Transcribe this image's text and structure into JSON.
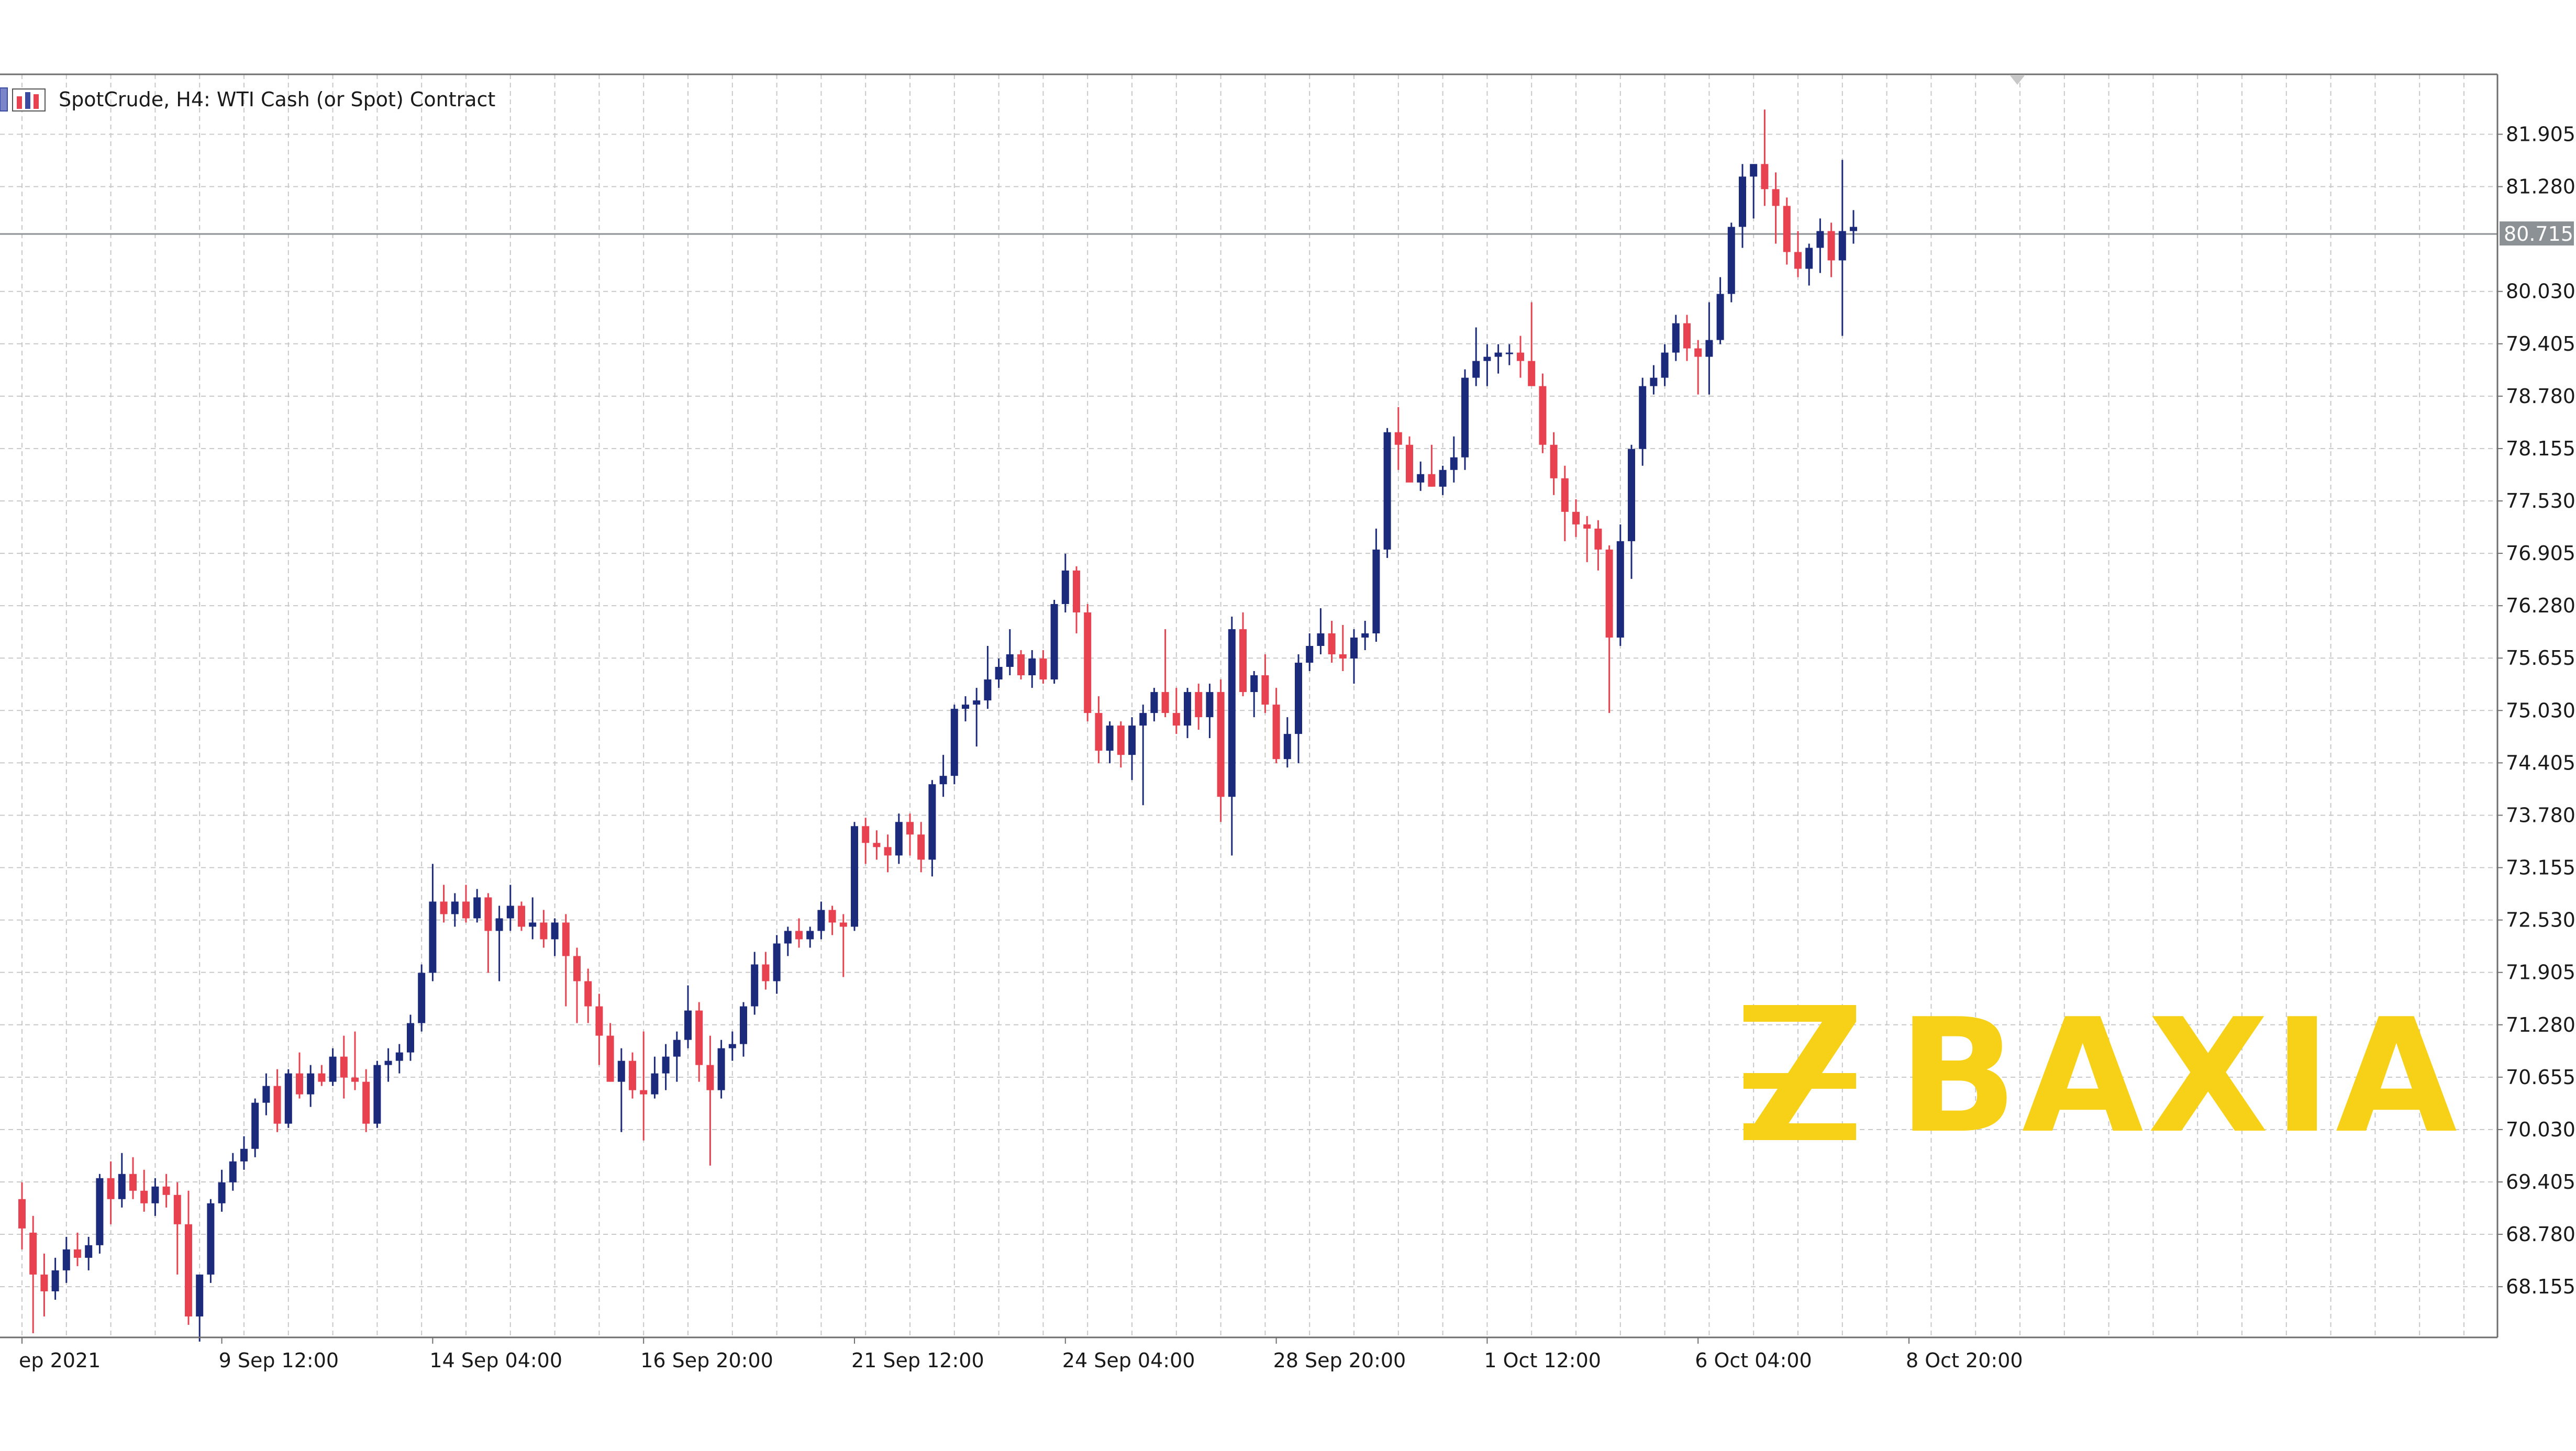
{
  "header": {
    "symbol_label": "SpotCrude, H4:  WTI Cash (or Spot) Contract"
  },
  "brand": {
    "name": "BAXIA",
    "color": "#F7D117"
  },
  "icons": {
    "header_icon": "chart-window-icon"
  },
  "colors": {
    "bull": "#1B2A7A",
    "bear": "#E8414F",
    "grid": "#C8C8C8",
    "axis": "#6E6E6E",
    "last_price_line": "#8C9196",
    "last_price_bg": "#8C9196"
  },
  "chart_data": {
    "type": "candlestick",
    "y_axis": {
      "ticks": [
        "81.905",
        "81.280",
        "80.030",
        "79.405",
        "78.780",
        "78.155",
        "77.530",
        "76.905",
        "76.280",
        "75.655",
        "75.030",
        "74.405",
        "73.780",
        "73.155",
        "72.530",
        "71.905",
        "71.280",
        "70.655",
        "70.030",
        "69.405",
        "68.780",
        "68.155"
      ],
      "ylim": [
        67.55,
        82.62
      ]
    },
    "x_axis": {
      "ticks": [
        "ep 2021",
        "9 Sep 12:00",
        "14 Sep 04:00",
        "16 Sep 20:00",
        "21 Sep 12:00",
        "24 Sep 04:00",
        "28 Sep 20:00",
        "1 Oct 12:00",
        "6 Oct 04:00",
        "8 Oct 20:00"
      ],
      "tick_bars": [
        0,
        18,
        37,
        56,
        75,
        94,
        113,
        132,
        151,
        170
      ]
    },
    "last_price": "80.715",
    "grid": true,
    "candles": [
      [
        69.2,
        69.4,
        68.6,
        68.85
      ],
      [
        68.8,
        69.0,
        67.6,
        68.3
      ],
      [
        68.3,
        68.55,
        67.8,
        68.1
      ],
      [
        68.1,
        68.5,
        68.0,
        68.35
      ],
      [
        68.35,
        68.75,
        68.2,
        68.6
      ],
      [
        68.6,
        68.8,
        68.4,
        68.5
      ],
      [
        68.5,
        68.75,
        68.35,
        68.65
      ],
      [
        68.65,
        69.5,
        68.55,
        69.45
      ],
      [
        69.45,
        69.65,
        68.9,
        69.2
      ],
      [
        69.2,
        69.75,
        69.1,
        69.5
      ],
      [
        69.5,
        69.7,
        69.2,
        69.3
      ],
      [
        69.3,
        69.55,
        69.05,
        69.15
      ],
      [
        69.15,
        69.45,
        69.0,
        69.35
      ],
      [
        69.35,
        69.5,
        69.1,
        69.25
      ],
      [
        69.25,
        69.4,
        68.3,
        68.9
      ],
      [
        68.9,
        69.3,
        67.7,
        67.8
      ],
      [
        67.8,
        68.3,
        67.5,
        68.3
      ],
      [
        68.3,
        69.2,
        68.2,
        69.15
      ],
      [
        69.15,
        69.55,
        69.05,
        69.4
      ],
      [
        69.4,
        69.75,
        69.3,
        69.65
      ],
      [
        69.65,
        69.95,
        69.55,
        69.8
      ],
      [
        69.8,
        70.4,
        69.7,
        70.35
      ],
      [
        70.35,
        70.7,
        70.2,
        70.55
      ],
      [
        70.55,
        70.75,
        70.0,
        70.1
      ],
      [
        70.1,
        70.75,
        70.05,
        70.7
      ],
      [
        70.7,
        70.95,
        70.4,
        70.45
      ],
      [
        70.45,
        70.8,
        70.3,
        70.7
      ],
      [
        70.7,
        70.8,
        70.55,
        70.6
      ],
      [
        70.6,
        71.0,
        70.55,
        70.9
      ],
      [
        70.9,
        71.15,
        70.4,
        70.65
      ],
      [
        70.65,
        71.2,
        70.5,
        70.6
      ],
      [
        70.6,
        70.75,
        70.0,
        70.1
      ],
      [
        70.1,
        70.85,
        70.05,
        70.8
      ],
      [
        70.8,
        71.0,
        70.6,
        70.85
      ],
      [
        70.85,
        71.05,
        70.7,
        70.95
      ],
      [
        70.95,
        71.4,
        70.85,
        71.3
      ],
      [
        71.3,
        72.0,
        71.2,
        71.9
      ],
      [
        71.9,
        73.2,
        71.8,
        72.75
      ],
      [
        72.75,
        72.95,
        72.5,
        72.6
      ],
      [
        72.6,
        72.85,
        72.45,
        72.75
      ],
      [
        72.75,
        72.95,
        72.5,
        72.55
      ],
      [
        72.55,
        72.9,
        72.5,
        72.8
      ],
      [
        72.8,
        72.85,
        71.9,
        72.4
      ],
      [
        72.4,
        72.7,
        71.8,
        72.55
      ],
      [
        72.55,
        72.95,
        72.4,
        72.7
      ],
      [
        72.7,
        72.75,
        72.4,
        72.45
      ],
      [
        72.45,
        72.8,
        72.3,
        72.5
      ],
      [
        72.5,
        72.65,
        72.2,
        72.3
      ],
      [
        72.3,
        72.55,
        72.1,
        72.5
      ],
      [
        72.5,
        72.6,
        71.5,
        72.1
      ],
      [
        72.1,
        72.2,
        71.3,
        71.8
      ],
      [
        71.8,
        71.95,
        71.3,
        71.5
      ],
      [
        71.5,
        71.65,
        70.8,
        71.15
      ],
      [
        71.15,
        71.3,
        70.6,
        70.6
      ],
      [
        70.6,
        71.0,
        70.0,
        70.85
      ],
      [
        70.85,
        70.95,
        70.4,
        70.5
      ],
      [
        70.5,
        71.2,
        69.9,
        70.45
      ],
      [
        70.45,
        70.9,
        70.4,
        70.7
      ],
      [
        70.7,
        71.05,
        70.5,
        70.9
      ],
      [
        70.9,
        71.2,
        70.6,
        71.1
      ],
      [
        71.1,
        71.75,
        71.0,
        71.45
      ],
      [
        71.45,
        71.55,
        70.6,
        70.8
      ],
      [
        70.8,
        71.15,
        69.6,
        70.5
      ],
      [
        70.5,
        71.1,
        70.4,
        71.0
      ],
      [
        71.0,
        71.2,
        70.85,
        71.05
      ],
      [
        71.05,
        71.55,
        70.9,
        71.5
      ],
      [
        71.5,
        72.15,
        71.4,
        72.0
      ],
      [
        72.0,
        72.15,
        71.7,
        71.8
      ],
      [
        71.8,
        72.35,
        71.65,
        72.25
      ],
      [
        72.25,
        72.45,
        72.1,
        72.4
      ],
      [
        72.4,
        72.55,
        72.2,
        72.3
      ],
      [
        72.3,
        72.45,
        72.2,
        72.4
      ],
      [
        72.4,
        72.75,
        72.3,
        72.65
      ],
      [
        72.65,
        72.7,
        72.35,
        72.5
      ],
      [
        72.5,
        72.6,
        71.85,
        72.45
      ],
      [
        72.45,
        73.7,
        72.4,
        73.65
      ],
      [
        73.65,
        73.75,
        73.2,
        73.45
      ],
      [
        73.45,
        73.6,
        73.25,
        73.4
      ],
      [
        73.4,
        73.55,
        73.1,
        73.3
      ],
      [
        73.3,
        73.8,
        73.2,
        73.7
      ],
      [
        73.7,
        73.8,
        73.3,
        73.55
      ],
      [
        73.55,
        73.7,
        73.1,
        73.25
      ],
      [
        73.25,
        74.2,
        73.05,
        74.15
      ],
      [
        74.15,
        74.5,
        74.0,
        74.25
      ],
      [
        74.25,
        75.1,
        74.15,
        75.05
      ],
      [
        75.05,
        75.2,
        74.9,
        75.1
      ],
      [
        75.1,
        75.3,
        74.6,
        75.15
      ],
      [
        75.15,
        75.8,
        75.05,
        75.4
      ],
      [
        75.4,
        75.65,
        75.3,
        75.55
      ],
      [
        75.55,
        76.0,
        75.45,
        75.7
      ],
      [
        75.7,
        75.75,
        75.4,
        75.45
      ],
      [
        75.45,
        75.75,
        75.3,
        75.65
      ],
      [
        75.65,
        75.75,
        75.35,
        75.4
      ],
      [
        75.4,
        76.35,
        75.35,
        76.3
      ],
      [
        76.3,
        76.9,
        76.2,
        76.7
      ],
      [
        76.7,
        76.75,
        75.95,
        76.2
      ],
      [
        76.2,
        76.3,
        74.9,
        75.0
      ],
      [
        75.0,
        75.2,
        74.4,
        74.55
      ],
      [
        74.55,
        74.9,
        74.4,
        74.85
      ],
      [
        74.85,
        74.9,
        74.35,
        74.5
      ],
      [
        74.5,
        74.95,
        74.2,
        74.85
      ],
      [
        74.85,
        75.1,
        73.9,
        75.0
      ],
      [
        75.0,
        75.3,
        74.9,
        75.25
      ],
      [
        75.25,
        76.0,
        74.95,
        75.0
      ],
      [
        75.0,
        75.3,
        74.75,
        74.85
      ],
      [
        74.85,
        75.3,
        74.7,
        75.25
      ],
      [
        75.25,
        75.35,
        74.8,
        74.95
      ],
      [
        74.95,
        75.35,
        74.7,
        75.25
      ],
      [
        75.25,
        75.4,
        73.7,
        74.0
      ],
      [
        74.0,
        76.15,
        73.3,
        76.0
      ],
      [
        76.0,
        76.2,
        75.2,
        75.25
      ],
      [
        75.25,
        75.5,
        74.95,
        75.45
      ],
      [
        75.45,
        75.7,
        75.0,
        75.1
      ],
      [
        75.1,
        75.3,
        74.4,
        74.45
      ],
      [
        74.45,
        74.95,
        74.35,
        74.75
      ],
      [
        74.75,
        75.7,
        74.4,
        75.6
      ],
      [
        75.6,
        75.95,
        75.5,
        75.8
      ],
      [
        75.8,
        76.25,
        75.7,
        75.95
      ],
      [
        75.95,
        76.1,
        75.6,
        75.7
      ],
      [
        75.7,
        76.05,
        75.5,
        75.65
      ],
      [
        75.65,
        76.0,
        75.35,
        75.9
      ],
      [
        75.9,
        76.1,
        75.75,
        75.95
      ],
      [
        75.95,
        77.2,
        75.85,
        76.95
      ],
      [
        76.95,
        78.4,
        76.85,
        78.35
      ],
      [
        78.35,
        78.65,
        77.9,
        78.2
      ],
      [
        78.2,
        78.3,
        77.8,
        77.75
      ],
      [
        77.75,
        78.0,
        77.65,
        77.85
      ],
      [
        77.85,
        78.2,
        77.7,
        77.7
      ],
      [
        77.7,
        77.95,
        77.6,
        77.9
      ],
      [
        77.9,
        78.3,
        77.75,
        78.05
      ],
      [
        78.05,
        79.1,
        77.9,
        79.0
      ],
      [
        79.0,
        79.6,
        78.9,
        79.2
      ],
      [
        79.2,
        79.4,
        78.9,
        79.25
      ],
      [
        79.25,
        79.4,
        79.05,
        79.3
      ],
      [
        79.3,
        79.4,
        79.15,
        79.3
      ],
      [
        79.3,
        79.5,
        79.0,
        79.2
      ],
      [
        79.2,
        79.9,
        79.1,
        78.9
      ],
      [
        78.9,
        79.05,
        78.1,
        78.2
      ],
      [
        78.2,
        78.35,
        77.6,
        77.8
      ],
      [
        77.8,
        77.95,
        77.05,
        77.4
      ],
      [
        77.4,
        77.55,
        77.1,
        77.25
      ],
      [
        77.25,
        77.35,
        76.8,
        77.2
      ],
      [
        77.2,
        77.3,
        76.7,
        76.95
      ],
      [
        76.95,
        77.0,
        75.0,
        75.9
      ],
      [
        75.9,
        77.25,
        75.8,
        77.05
      ],
      [
        77.05,
        78.2,
        76.6,
        78.15
      ],
      [
        78.15,
        79.0,
        77.95,
        78.9
      ],
      [
        78.9,
        79.15,
        78.8,
        79.0
      ],
      [
        79.0,
        79.4,
        78.9,
        79.3
      ],
      [
        79.3,
        79.75,
        79.2,
        79.65
      ],
      [
        79.65,
        79.75,
        79.2,
        79.35
      ],
      [
        79.35,
        79.45,
        78.8,
        79.25
      ],
      [
        79.25,
        79.9,
        78.8,
        79.45
      ],
      [
        79.45,
        80.2,
        79.4,
        80.0
      ],
      [
        80.0,
        80.85,
        79.9,
        80.8
      ],
      [
        80.8,
        81.55,
        80.55,
        81.4
      ],
      [
        81.4,
        81.55,
        80.9,
        81.55
      ],
      [
        81.55,
        82.2,
        81.05,
        81.25
      ],
      [
        81.25,
        81.45,
        80.6,
        81.05
      ],
      [
        81.05,
        81.15,
        80.35,
        80.5
      ],
      [
        80.5,
        80.75,
        80.2,
        80.3
      ],
      [
        80.3,
        80.6,
        80.1,
        80.55
      ],
      [
        80.55,
        80.9,
        80.25,
        80.75
      ],
      [
        80.75,
        80.85,
        80.2,
        80.4
      ],
      [
        80.4,
        81.6,
        79.5,
        80.75
      ],
      [
        80.75,
        81.0,
        80.6,
        80.8
      ]
    ]
  }
}
